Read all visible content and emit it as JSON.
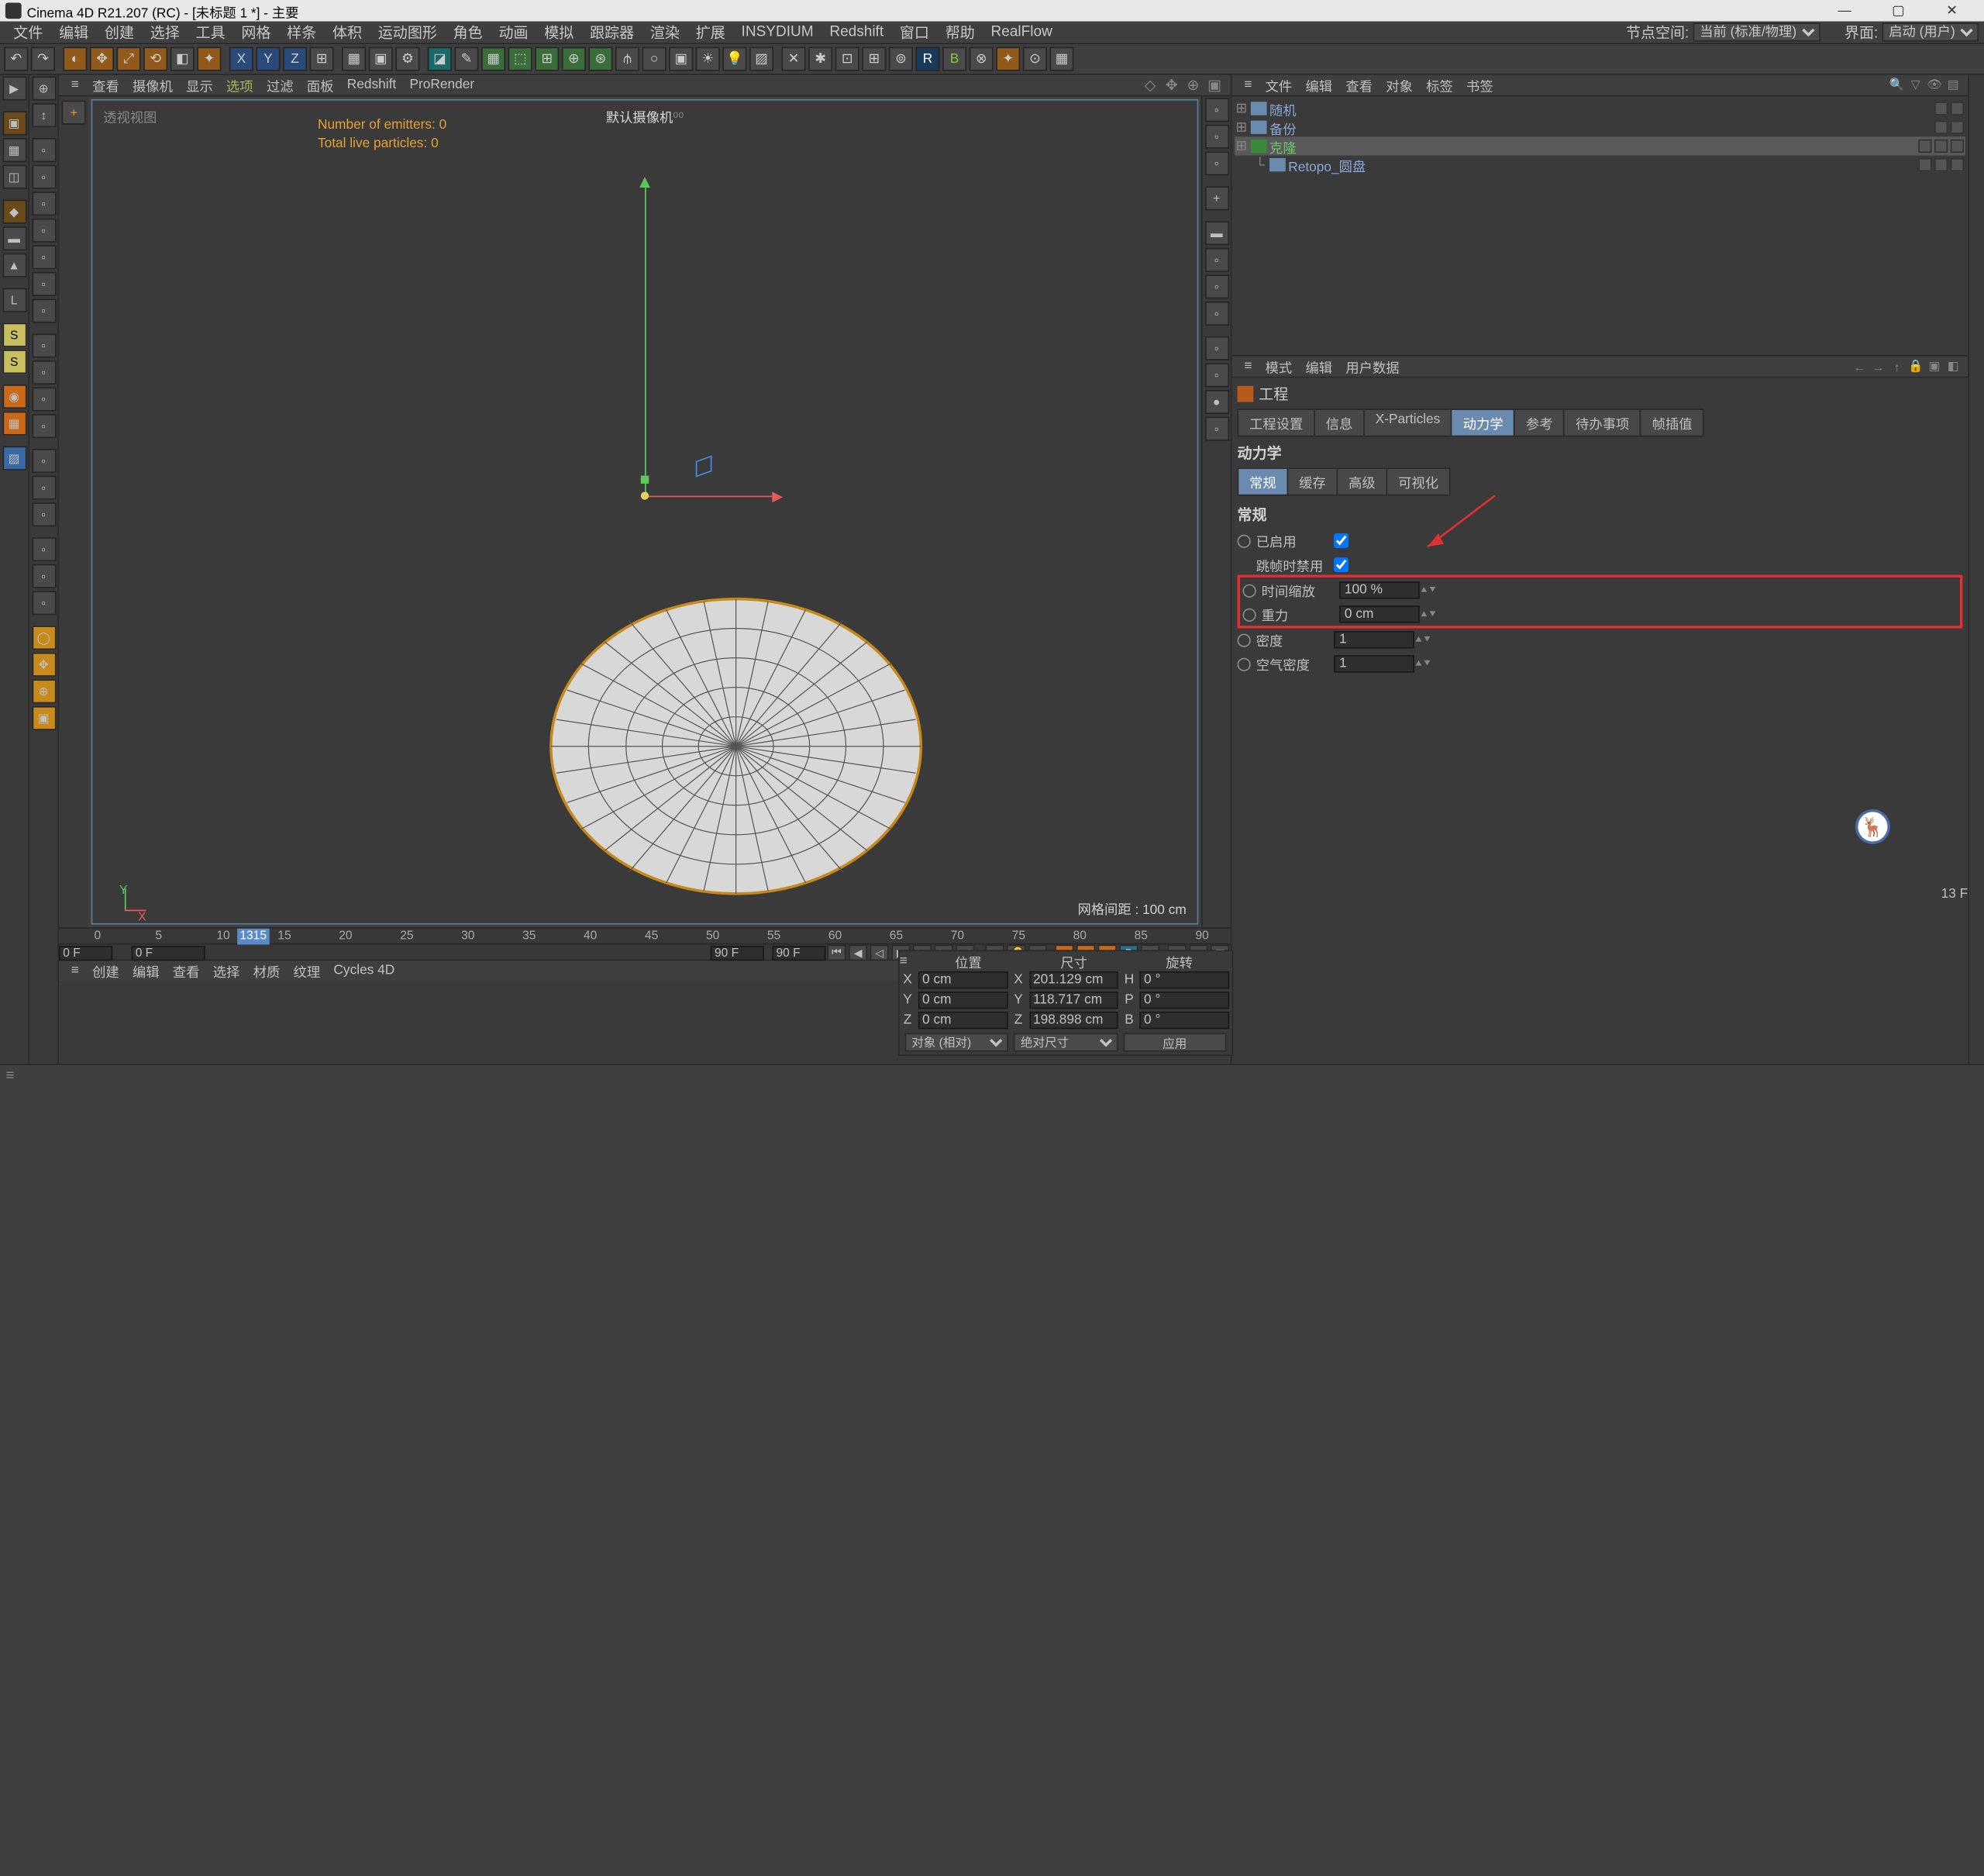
{
  "title": "Cinema 4D R21.207 (RC) - [未标题 1 *] - 主要",
  "menubar": [
    "文件",
    "编辑",
    "创建",
    "选择",
    "工具",
    "网格",
    "样条",
    "体积",
    "运动图形",
    "角色",
    "动画",
    "模拟",
    "跟踪器",
    "渲染",
    "扩展",
    "INSYDIUM",
    "Redshift",
    "窗口",
    "帮助",
    "RealFlow"
  ],
  "menuright": {
    "nodespace_label": "节点空间:",
    "nodespace_value": "当前 (标准/物理)",
    "layout_label": "界面:",
    "layout_value": "启动 (用户)"
  },
  "vpstrip": [
    "查看",
    "摄像机",
    "显示",
    "选项",
    "过滤",
    "面板",
    "Redshift",
    "ProRender"
  ],
  "viewport": {
    "label": "透视视图",
    "overlay1": "Number of emitters: 0",
    "overlay2": "Total live particles: 0",
    "camera": "默认摄像机",
    "gridinfo": "网格间距 : 100 cm",
    "miniY": "Y",
    "miniX": "X"
  },
  "timeline": {
    "ticks": [
      "0",
      "5",
      "10",
      "15",
      "20",
      "25",
      "30",
      "35",
      "40",
      "45",
      "50",
      "55",
      "60",
      "65",
      "70",
      "75",
      "80",
      "85",
      "90"
    ],
    "pos": "13",
    "startF": "0 F",
    "curF": "0 F",
    "endF": "90 F",
    "totF": "90 F",
    "rightFrame": "13 F"
  },
  "botstrip": [
    "创建",
    "编辑",
    "查看",
    "选择",
    "材质",
    "纹理",
    "Cycles 4D"
  ],
  "coords": {
    "head": [
      "位置",
      "尺寸",
      "旋转"
    ],
    "rows": [
      {
        "axis": "X",
        "p": "0 cm",
        "s": "201.129 cm",
        "rlab": "H",
        "r": "0 °"
      },
      {
        "axis": "Y",
        "p": "0 cm",
        "s": "118.717 cm",
        "rlab": "P",
        "r": "0 °"
      },
      {
        "axis": "Z",
        "p": "0 cm",
        "s": "198.898 cm",
        "rlab": "B",
        "r": "0 °"
      }
    ],
    "mode1": "对象 (相对)",
    "mode2": "绝对尺寸",
    "apply": "应用"
  },
  "objmgr": {
    "head": [
      "文件",
      "编辑",
      "查看",
      "对象",
      "标签",
      "书签"
    ],
    "items": [
      {
        "name": "随机",
        "cls": "",
        "indent": 0
      },
      {
        "name": "备份",
        "cls": "",
        "indent": 0
      },
      {
        "name": "克隆",
        "cls": "green sel",
        "indent": 0
      },
      {
        "name": "Retopo_圆盘",
        "cls": "",
        "indent": 1
      }
    ]
  },
  "attr": {
    "head": [
      "模式",
      "编辑",
      "用户数据"
    ],
    "project": "工程",
    "tabs": [
      "工程设置",
      "信息",
      "X-Particles",
      "动力学",
      "参考",
      "待办事项",
      "帧插值"
    ],
    "active_tab": "动力学",
    "group": "动力学",
    "subtabs": [
      "常规",
      "缓存",
      "高级",
      "可视化"
    ],
    "active_sub": "常规",
    "section": "常规",
    "params": [
      {
        "label": "已启用",
        "type": "check",
        "checked": true
      },
      {
        "label": "跳帧时禁用",
        "type": "check",
        "checked": true,
        "noring": true
      },
      {
        "label": "时间缩放",
        "type": "num",
        "value": "100 %"
      },
      {
        "label": "重力",
        "type": "num",
        "value": "0 cm"
      },
      {
        "label": "密度",
        "type": "num",
        "value": "1"
      },
      {
        "label": "空气密度",
        "type": "num",
        "value": "1"
      }
    ]
  }
}
